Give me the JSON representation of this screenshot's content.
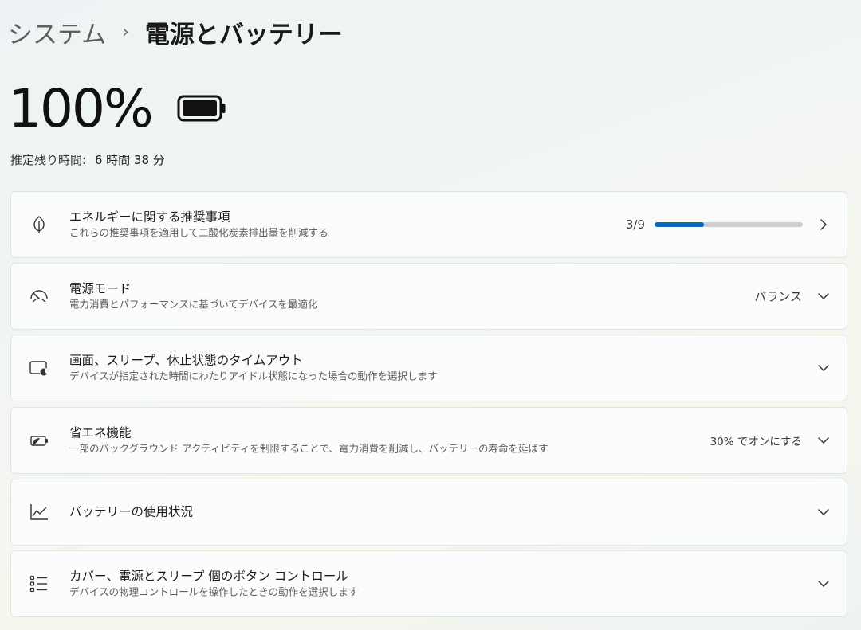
{
  "breadcrumb": {
    "parent": "システム",
    "separator": "›",
    "current": "電源とバッテリー"
  },
  "battery": {
    "percent_label": "100%",
    "level": 1.0,
    "remaining_label": "推定残り時間:",
    "remaining_value": "6 時間 38 分"
  },
  "cards": [
    {
      "title": "エネルギーに関する推奨事項",
      "subtitle": "これらの推奨事項を適用して二酸化炭素排出量を削減する",
      "icon": "leaf-icon",
      "progress_label": "3/9",
      "progress": 0.3333,
      "chevron": "chevron-right-icon"
    },
    {
      "title": "電源モード",
      "subtitle": "電力消費とパフォーマンスに基づいてデバイスを最適化",
      "icon": "gauge-icon",
      "value": "バランス",
      "chevron": "chevron-down-icon"
    },
    {
      "title": "画面、スリープ、休止状態のタイムアウト",
      "subtitle": "デバイスが指定された時間にわたりアイドル状態になった場合の動作を選択します",
      "icon": "screen-sleep-icon",
      "chevron": "chevron-down-icon"
    },
    {
      "title": "省エネ機能",
      "subtitle": "一部のバックグラウンド アクティビティを制限することで、電力消費を削減し、バッテリーの寿命を延ばす",
      "icon": "battery-saver-icon",
      "value": "30% でオンにする",
      "chevron": "chevron-down-icon"
    },
    {
      "title": "バッテリーの使用状況",
      "icon": "line-chart-icon",
      "chevron": "chevron-down-icon"
    },
    {
      "title": "カバー、電源とスリープ 個のボタン コントロール",
      "subtitle": "デバイスの物理コントロールを操作したときの動作を選択します",
      "icon": "list-icon",
      "chevron": "chevron-down-icon"
    }
  ],
  "colors": {
    "accent": "#0f6cbd",
    "track": "#cfcfcf",
    "card_bg": "#fbfcfc",
    "card_border": "#e1e4e5"
  }
}
